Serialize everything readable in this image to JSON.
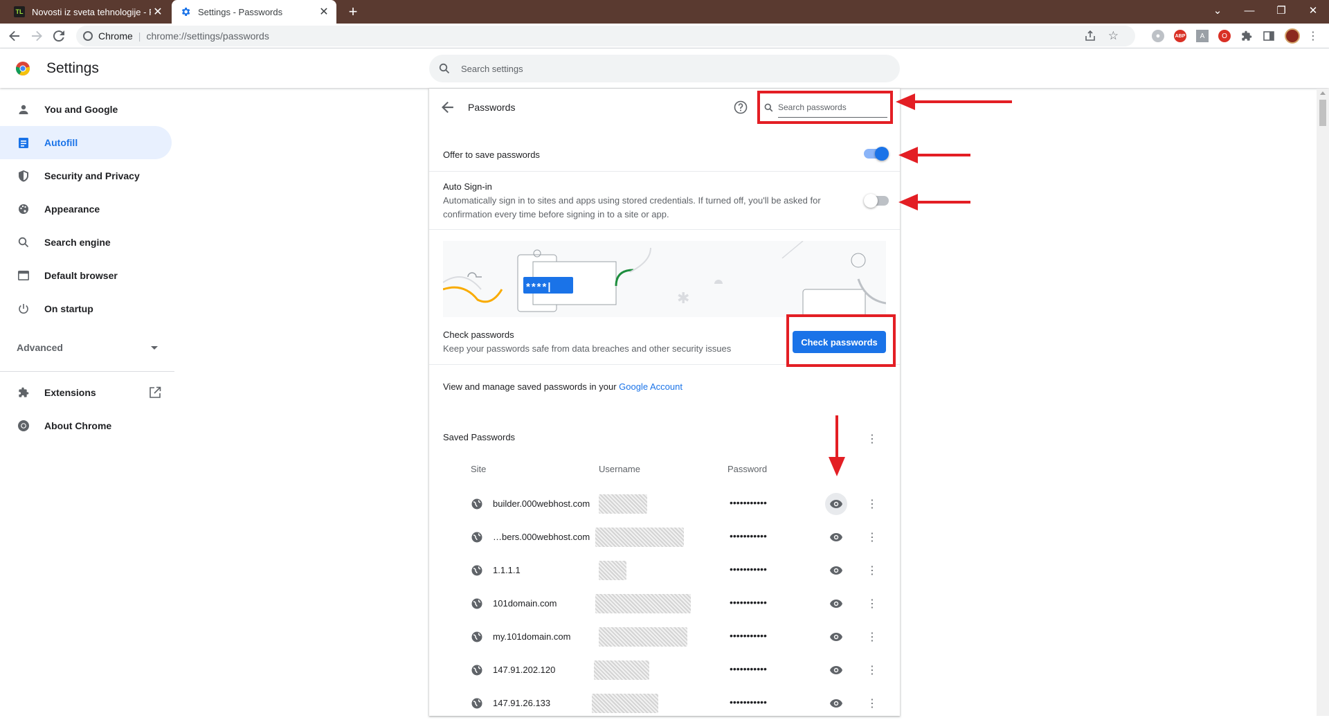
{
  "tabs": [
    {
      "title": "Novosti iz sveta tehnologije - Pa",
      "favicon": "TL"
    },
    {
      "title": "Settings - Passwords"
    }
  ],
  "toolbar": {
    "site_label": "Chrome",
    "url": "chrome://settings/passwords"
  },
  "header": {
    "title": "Settings",
    "search_placeholder": "Search settings"
  },
  "sidebar": {
    "items": [
      {
        "label": "You and Google",
        "icon": "person-icon"
      },
      {
        "label": "Autofill",
        "icon": "autofill-icon",
        "active": true
      },
      {
        "label": "Security and Privacy",
        "icon": "shield-icon"
      },
      {
        "label": "Appearance",
        "icon": "palette-icon"
      },
      {
        "label": "Search engine",
        "icon": "search-icon"
      },
      {
        "label": "Default browser",
        "icon": "browser-icon"
      },
      {
        "label": "On startup",
        "icon": "power-icon"
      }
    ],
    "advanced_label": "Advanced",
    "extensions_label": "Extensions",
    "about_label": "About Chrome"
  },
  "passwords": {
    "title": "Passwords",
    "search_placeholder": "Search passwords",
    "offer_to_save_label": "Offer to save passwords",
    "offer_to_save_enabled": true,
    "auto_signin_label": "Auto Sign-in",
    "auto_signin_desc_line1": "Automatically sign in to sites and apps using stored credentials. If turned off, you'll be asked for",
    "auto_signin_desc_line2": "confirmation every time before signing in to a site or app.",
    "auto_signin_enabled": false,
    "illustration_mask": "****|",
    "check_title": "Check passwords",
    "check_desc": "Keep your passwords safe from data breaches and other security issues",
    "check_button": "Check passwords",
    "manage_text": "View and manage saved passwords in your ",
    "manage_link": "Google Account",
    "saved_title": "Saved Passwords",
    "columns": {
      "site": "Site",
      "username": "Username",
      "password": "Password"
    },
    "entries": [
      {
        "site": "builder.000webhost.com",
        "password": "•••••••••••"
      },
      {
        "site": "…bers.000webhost.com",
        "password": "•••••••••••"
      },
      {
        "site": "1.1.1.1",
        "password": "•••••••••••"
      },
      {
        "site": "101domain.com",
        "password": "•••••••••••"
      },
      {
        "site": "my.101domain.com",
        "password": "•••••••••••"
      },
      {
        "site": "147.91.202.120",
        "password": "•••••••••••"
      },
      {
        "site": "147.91.26.133",
        "password": "•••••••••••"
      }
    ]
  },
  "colors": {
    "accent": "#1a73e8",
    "annotation_red": "#e31e24",
    "tabstrip": "#5a3a30"
  }
}
